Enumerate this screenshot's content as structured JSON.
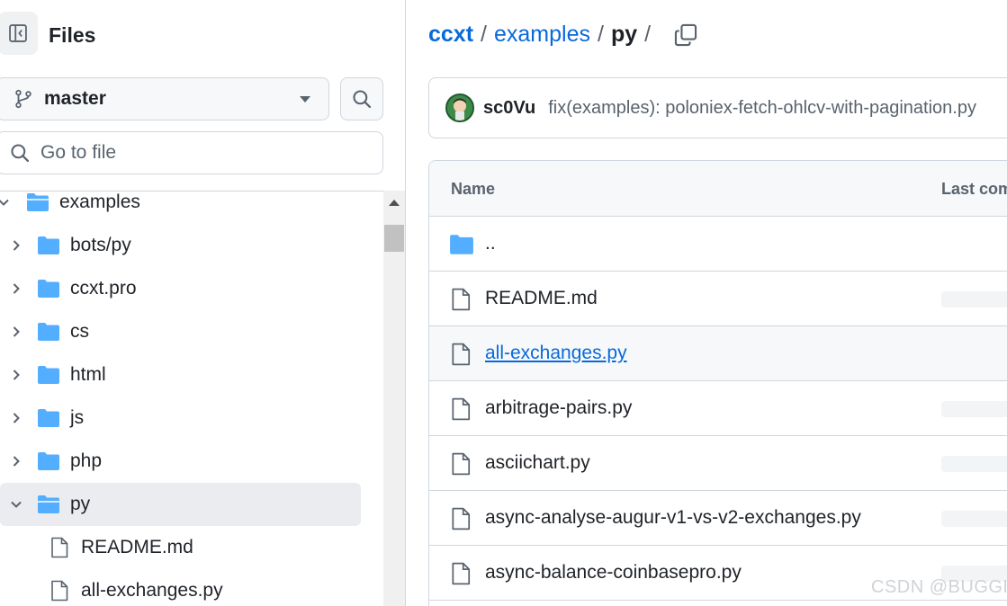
{
  "sidebar": {
    "title": "Files",
    "branch": "master",
    "goto_placeholder": "Go to file",
    "tree": [
      {
        "label": "examples",
        "kind": "folder",
        "expanded": true
      },
      {
        "label": "bots/py",
        "kind": "folder",
        "expanded": false
      },
      {
        "label": "ccxt.pro",
        "kind": "folder",
        "expanded": false
      },
      {
        "label": "cs",
        "kind": "folder",
        "expanded": false
      },
      {
        "label": "html",
        "kind": "folder",
        "expanded": false
      },
      {
        "label": "js",
        "kind": "folder",
        "expanded": false
      },
      {
        "label": "php",
        "kind": "folder",
        "expanded": false
      },
      {
        "label": "py",
        "kind": "folder",
        "expanded": true,
        "selected": true
      },
      {
        "label": "README.md",
        "kind": "file"
      },
      {
        "label": "all-exchanges.py",
        "kind": "file"
      }
    ]
  },
  "breadcrumb": {
    "repo": "ccxt",
    "folder": "examples",
    "current": "py",
    "sep": "/"
  },
  "commit": {
    "author": "sc0Vu",
    "message": "fix(examples): poloniex-fetch-ohlcv-with-pagination.py"
  },
  "table": {
    "col_name": "Name",
    "col_last": "Last com",
    "rows": [
      {
        "name": "..",
        "kind": "parent"
      },
      {
        "name": "README.md",
        "kind": "file"
      },
      {
        "name": "all-exchanges.py",
        "kind": "file",
        "hovered": true
      },
      {
        "name": "arbitrage-pairs.py",
        "kind": "file"
      },
      {
        "name": "asciichart.py",
        "kind": "file"
      },
      {
        "name": "async-analyse-augur-v1-vs-v2-exchanges.py",
        "kind": "file"
      },
      {
        "name": "async-balance-coinbasepro.py",
        "kind": "file"
      }
    ]
  },
  "watermark": "CSDN @BUGGI",
  "colors": {
    "accent": "#0969da",
    "folder": "#54aeff",
    "border": "#d0d7de",
    "muted": "#59636e"
  }
}
